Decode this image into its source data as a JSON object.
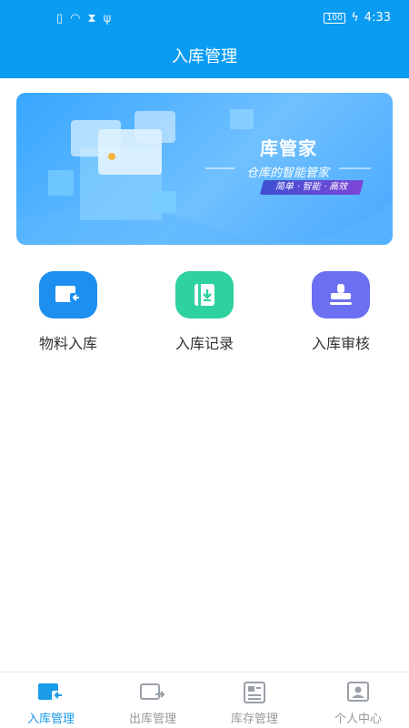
{
  "status_bar": {
    "battery": "100",
    "time": "4:33"
  },
  "header": {
    "title": "入库管理"
  },
  "banner": {
    "title": "库管家",
    "subtitle": "仓库的智能管家",
    "tags": "简单 · 智能 · 高效"
  },
  "features": [
    {
      "label": "物料入库",
      "icon": "material-inbound-icon",
      "color": "#1c8ff0"
    },
    {
      "label": "入库记录",
      "icon": "inbound-record-icon",
      "color": "#2ed1a0"
    },
    {
      "label": "入库审核",
      "icon": "stamp-icon",
      "color": "#6b70f2"
    }
  ],
  "tabs": [
    {
      "label": "入库管理",
      "icon": "inbound-tab-icon",
      "active": true
    },
    {
      "label": "出库管理",
      "icon": "outbound-tab-icon",
      "active": false
    },
    {
      "label": "库存管理",
      "icon": "inventory-tab-icon",
      "active": false
    },
    {
      "label": "个人中心",
      "icon": "profile-tab-icon",
      "active": false
    }
  ],
  "colors": {
    "primary": "#0a9cf3",
    "active_tab": "#1a9be8",
    "inactive_tab": "#999999"
  }
}
